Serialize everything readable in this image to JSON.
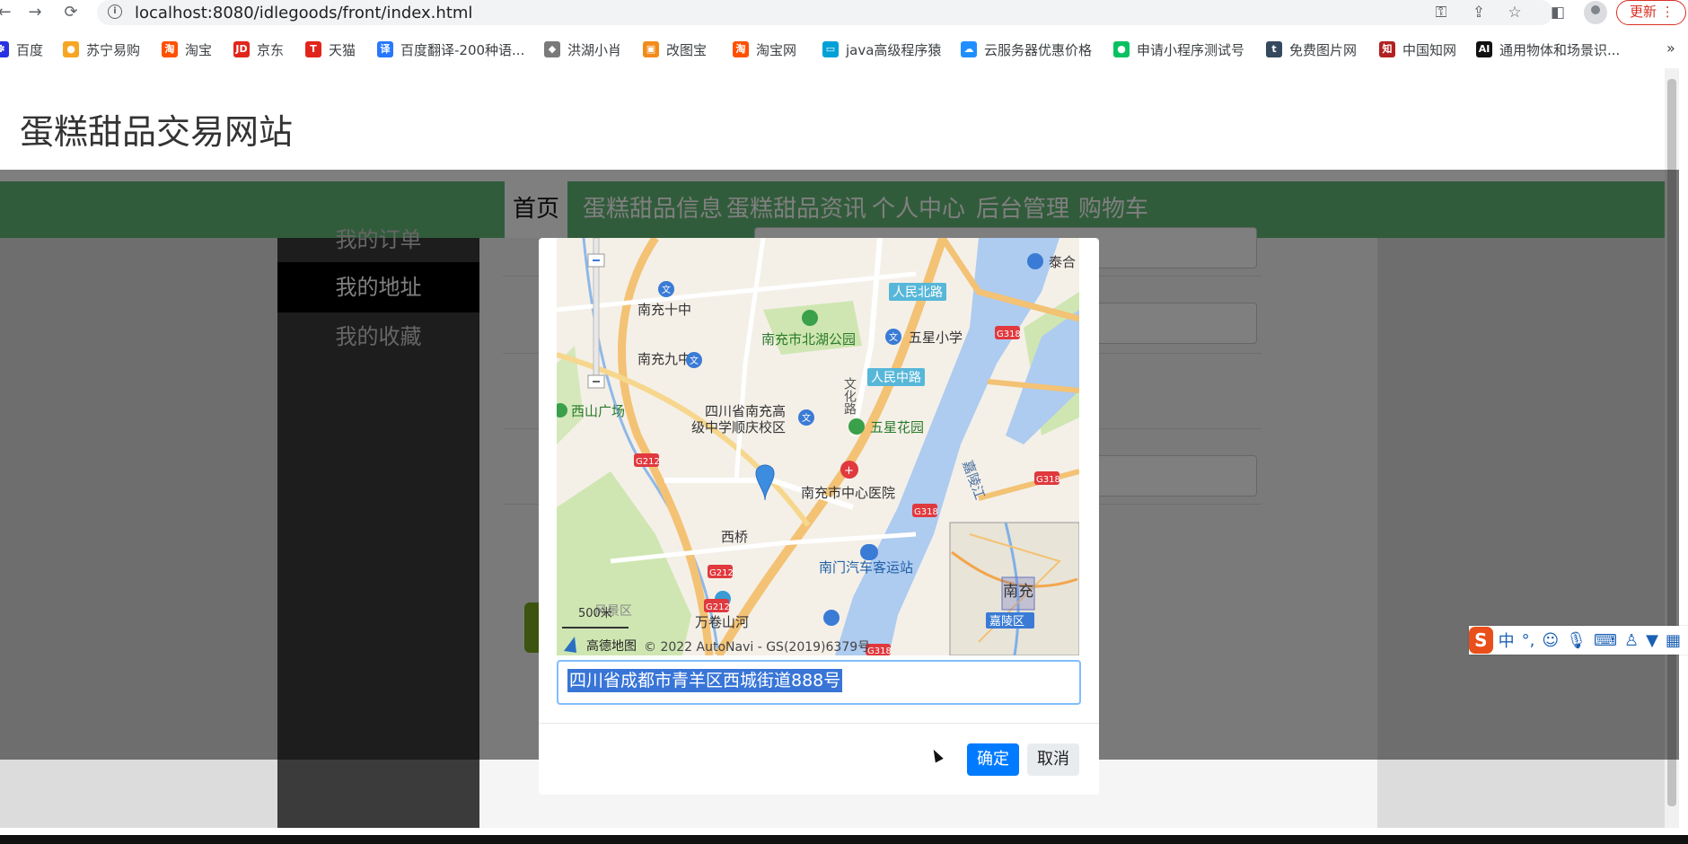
{
  "browser": {
    "url": "localhost:8080/idlegoods/front/index.html",
    "update_label": "更新",
    "more_label": "»",
    "bookmarks": [
      {
        "label": "百度",
        "color": "#2932e1",
        "glyph": "✽"
      },
      {
        "label": "苏宁易购",
        "color": "#f6a623",
        "glyph": "●"
      },
      {
        "label": "淘宝",
        "color": "#ff5000",
        "glyph": "淘"
      },
      {
        "label": "京东",
        "color": "#e1251b",
        "glyph": "JD"
      },
      {
        "label": "天猫",
        "color": "#e1251b",
        "glyph": "T"
      },
      {
        "label": "百度翻译-200种语...",
        "color": "#2878ff",
        "glyph": "译"
      },
      {
        "label": "洪湖小肖",
        "color": "#7a7a7a",
        "glyph": "◆"
      },
      {
        "label": "改图宝",
        "color": "#f28b1a",
        "glyph": "▣"
      },
      {
        "label": "淘宝网",
        "color": "#ff5000",
        "glyph": "淘"
      },
      {
        "label": "java高级程序猿",
        "color": "#00a1d6",
        "glyph": "▭"
      },
      {
        "label": "云服务器优惠价格",
        "color": "#1f8fff",
        "glyph": "☁"
      },
      {
        "label": "申请小程序测试号",
        "color": "#07c160",
        "glyph": "●"
      },
      {
        "label": "免费图片网",
        "color": "#34495e",
        "glyph": "t"
      },
      {
        "label": "中国知网",
        "color": "#b22222",
        "glyph": "知"
      },
      {
        "label": "通用物体和场景识...",
        "color": "#111111",
        "glyph": "AI"
      }
    ]
  },
  "site": {
    "title": "蛋糕甜品交易网站",
    "nav": [
      "首页",
      "蛋糕甜品信息",
      "蛋糕甜品资讯",
      "个人中心",
      "后台管理",
      "购物车"
    ],
    "sidebar": [
      "我的订单",
      "我的地址",
      "我的收藏"
    ]
  },
  "modal": {
    "address_value": "四川省成都市青羊区西城街道888号",
    "confirm_label": "确定",
    "cancel_label": "取消",
    "map": {
      "places": {
        "nanchong_10": "南充十中",
        "beihu_park": "南充市北湖公园",
        "wuxing_school": "五星小学",
        "renmin_north": "人民北路",
        "renmin_middle": "人民中路",
        "nanchong_9": "南充九中",
        "xishan_square": "西山广场",
        "high_school_1": "四川省南充高",
        "high_school_2": "级中学顺庆校区",
        "wuxing_garden": "五星花园",
        "wenhua_road": "文化路",
        "central_hospital": "南充市中心医院",
        "xiqiao": "西桥",
        "nanmen_bus": "南门汽车客运站",
        "wanjuan_mountain": "万卷山河",
        "jialing_river": "嘉陵江",
        "taihe": "泰合",
        "scenic_area": "风景区",
        "minimap_city": "南充",
        "minimap_district": "嘉陵区"
      },
      "highway_labels": [
        "G318",
        "G212",
        "G318",
        "G318",
        "G212",
        "G212",
        "G318"
      ],
      "scale_label": "500米",
      "brand": "高德地图",
      "copyright": "© 2022 AutoNavi - GS(2019)6379号"
    }
  },
  "ime": {
    "glyph": "S",
    "mode": "中"
  }
}
